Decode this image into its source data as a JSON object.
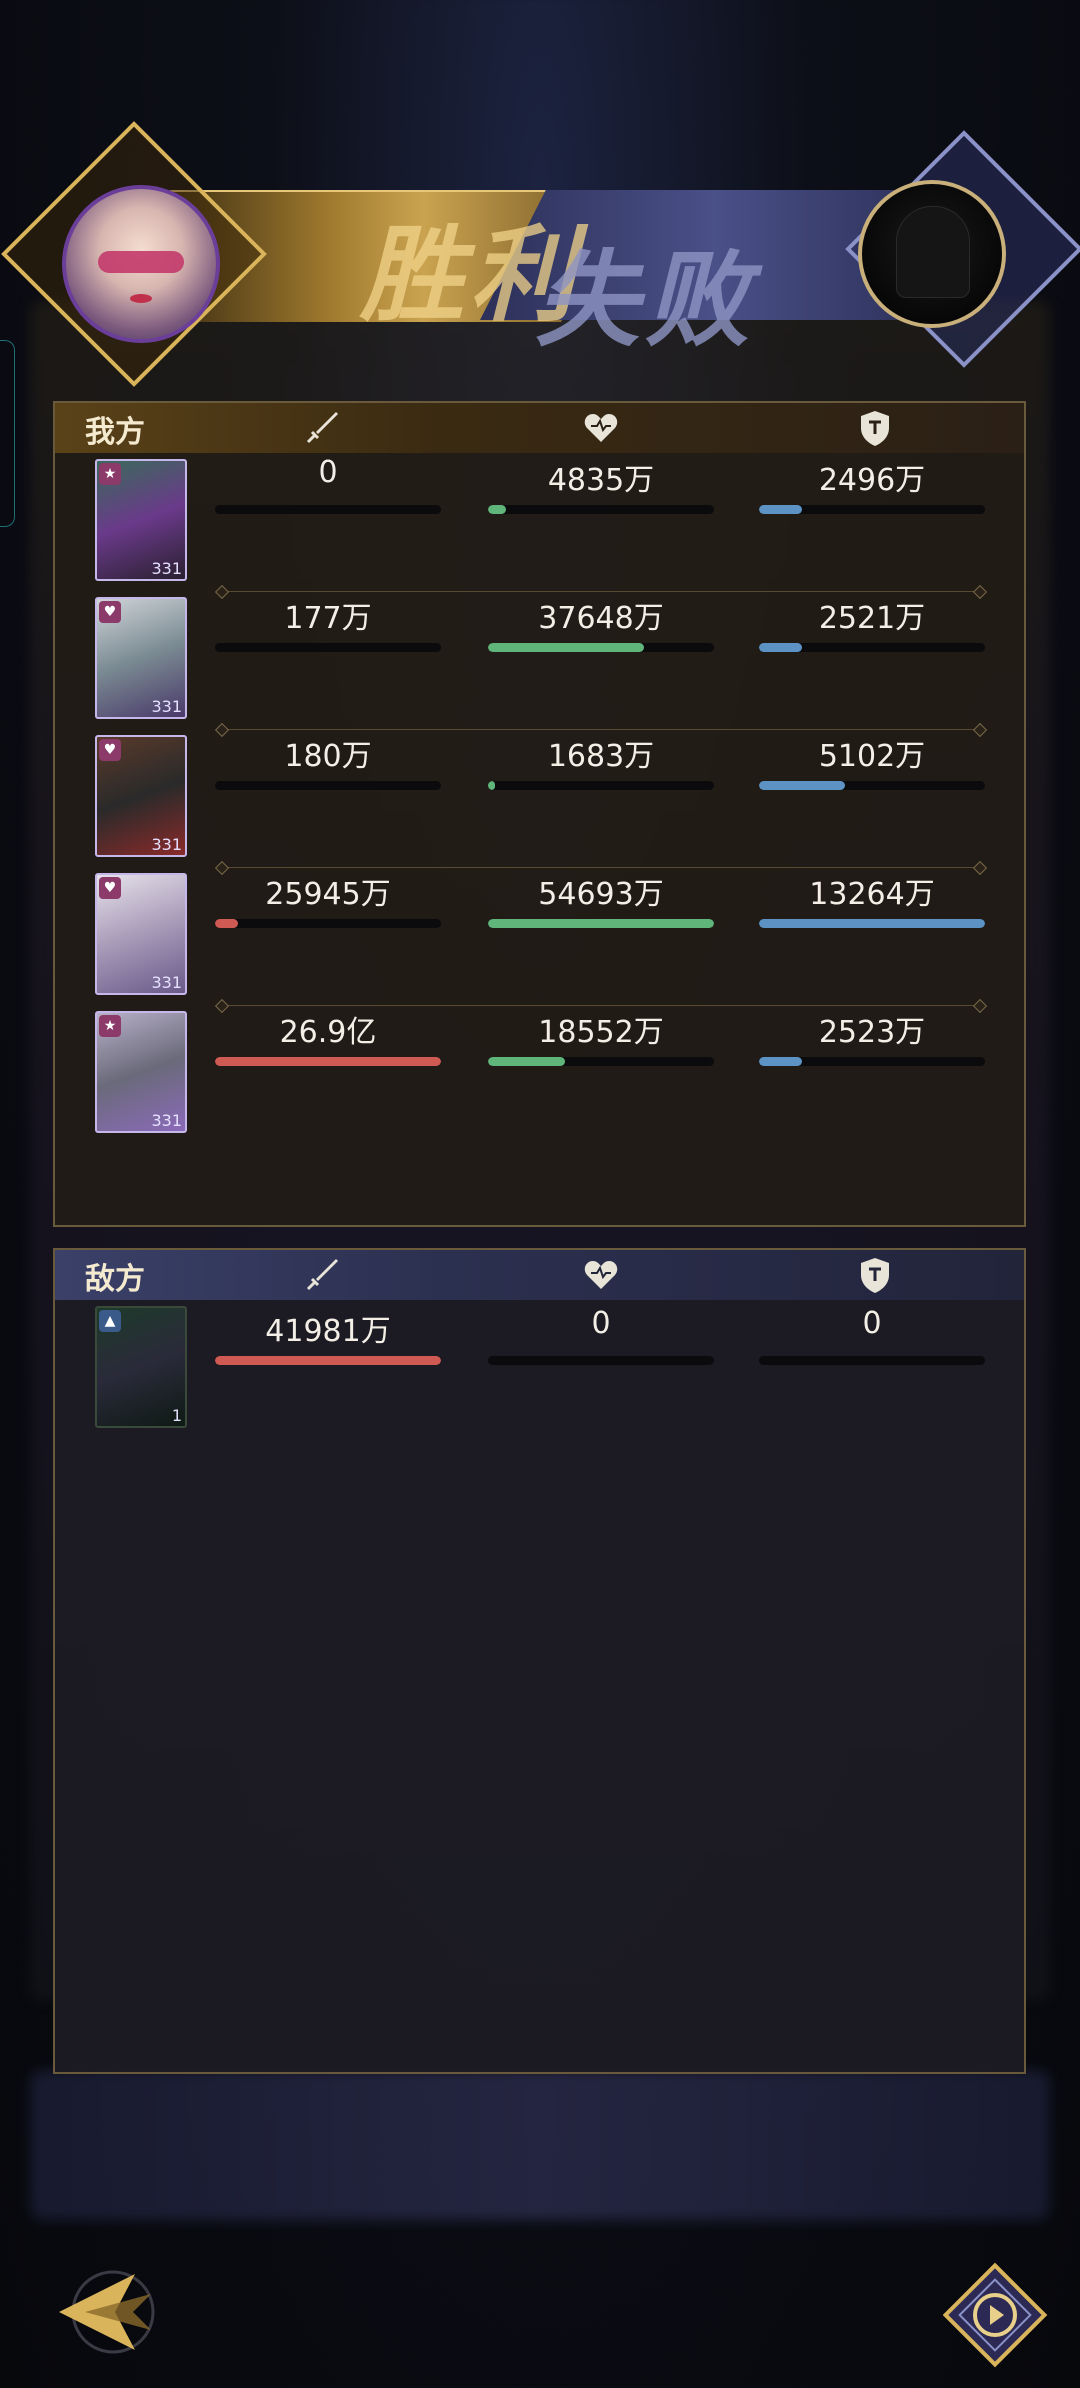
{
  "banner": {
    "win_text": "胜利",
    "lose_text": "失败"
  },
  "ally": {
    "title": "我方",
    "rows": [
      {
        "level": "331",
        "atk": "0",
        "atk_pct": 0,
        "hp": "4835万",
        "hp_pct": 8,
        "def": "2496万",
        "def_pct": 19
      },
      {
        "level": "331",
        "atk": "177万",
        "atk_pct": 0,
        "hp": "37648万",
        "hp_pct": 69,
        "def": "2521万",
        "def_pct": 19
      },
      {
        "level": "331",
        "atk": "180万",
        "atk_pct": 0,
        "hp": "1683万",
        "hp_pct": 3,
        "def": "5102万",
        "def_pct": 38
      },
      {
        "level": "331",
        "atk": "25945万",
        "atk_pct": 10,
        "hp": "54693万",
        "hp_pct": 100,
        "def": "13264万",
        "def_pct": 100
      },
      {
        "level": "331",
        "atk": "26.9亿",
        "atk_pct": 100,
        "hp": "18552万",
        "hp_pct": 34,
        "def": "2523万",
        "def_pct": 19
      }
    ]
  },
  "enemy": {
    "title": "敌方",
    "rows": [
      {
        "level": "1",
        "atk": "41981万",
        "atk_pct": 100,
        "hp": "0",
        "hp_pct": 0,
        "def": "0",
        "def_pct": 0
      }
    ]
  },
  "colors": {
    "atk": "#cf5a54",
    "hp": "#5fb57a",
    "def": "#5d93c4",
    "gold": "#d9b45a"
  }
}
